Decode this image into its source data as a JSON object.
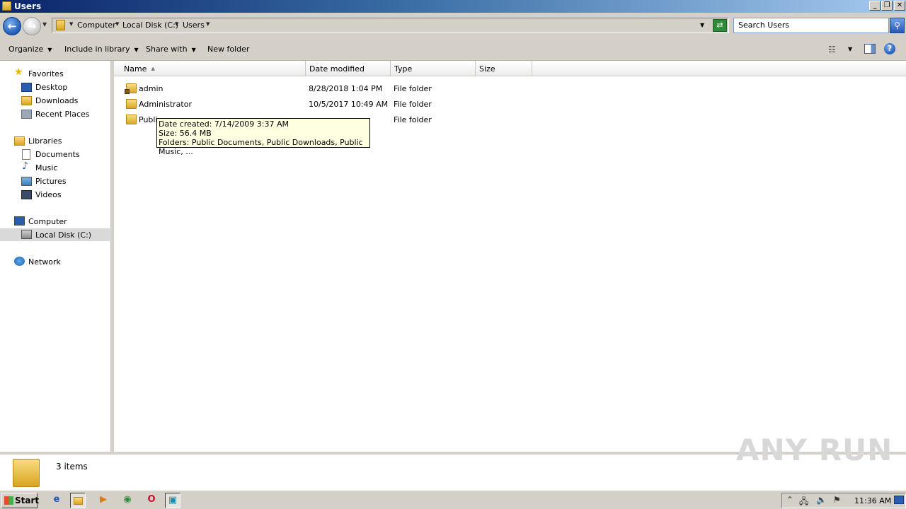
{
  "window": {
    "title": "Users"
  },
  "address": {
    "crumbs": [
      "Computer",
      "Local Disk (C:)",
      "Users"
    ],
    "search_placeholder": "Search Users"
  },
  "toolbar": {
    "organize": "Organize",
    "include_in_library": "Include in library",
    "share_with": "Share with",
    "new_folder": "New folder",
    "help": "?"
  },
  "nav": {
    "favorites": "Favorites",
    "desktop": "Desktop",
    "downloads": "Downloads",
    "recent_places": "Recent Places",
    "libraries": "Libraries",
    "documents": "Documents",
    "music": "Music",
    "pictures": "Pictures",
    "videos": "Videos",
    "computer": "Computer",
    "local_disk": "Local Disk (C:)",
    "network": "Network"
  },
  "columns": {
    "name": "Name",
    "date_modified": "Date modified",
    "type": "Type",
    "size": "Size"
  },
  "files": [
    {
      "name": "admin",
      "date": "8/28/2018 1:04 PM",
      "type": "File folder"
    },
    {
      "name": "Administrator",
      "date": "10/5/2017 10:49 AM",
      "type": "File folder"
    },
    {
      "name": "Public",
      "date": "",
      "type": "File folder"
    }
  ],
  "tooltip": {
    "line1": "Date created: 7/14/2009 3:37 AM",
    "line2": "Size: 56.4 MB",
    "line3": "Folders: Public Documents, Public Downloads, Public Music, ..."
  },
  "details": {
    "count": "3 items"
  },
  "watermark": "ANY RUN",
  "taskbar": {
    "start": "Start",
    "clock": "11:36 AM"
  }
}
